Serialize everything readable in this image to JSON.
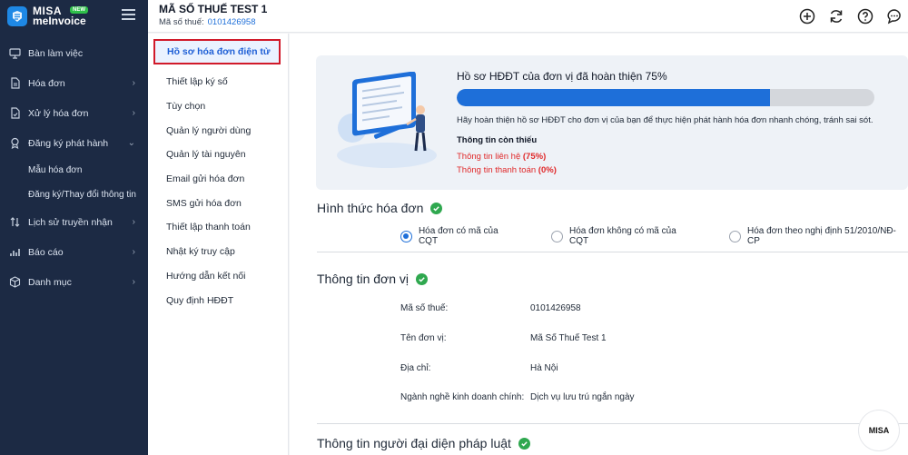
{
  "brand": {
    "name_line1": "MISA",
    "name_line2": "meInvoice",
    "badge": "NEW"
  },
  "sidebar": {
    "items": [
      {
        "label": "Bàn làm việc",
        "icon": "monitor-icon",
        "has_chevron": false
      },
      {
        "label": "Hóa đơn",
        "icon": "invoice-icon",
        "has_chevron": true
      },
      {
        "label": "Xử lý hóa đơn",
        "icon": "process-invoice-icon",
        "has_chevron": true
      },
      {
        "label": "Đăng ký phát hành",
        "icon": "award-icon",
        "has_chevron": true,
        "expanded": true
      },
      {
        "label": "Lịch sử truyền nhận",
        "icon": "transfer-icon",
        "has_chevron": true
      },
      {
        "label": "Báo cáo",
        "icon": "bar-chart-icon",
        "has_chevron": true
      },
      {
        "label": "Danh mục",
        "icon": "cube-icon",
        "has_chevron": true
      }
    ],
    "subitems": [
      "Mẫu hóa đơn",
      "Đăng ký/Thay đổi thông tin"
    ]
  },
  "header": {
    "company": "MÃ SỐ THUẾ TEST 1",
    "tax_label": "Mã số thuế:",
    "tax_value": "0101426958",
    "icons": [
      "add-circle-icon",
      "refresh-icon",
      "help-icon",
      "chat-icon"
    ]
  },
  "settings_menu": {
    "active": "Hồ sơ hóa đơn điện tử",
    "items": [
      "Thiết lập ký số",
      "Tùy chọn",
      "Quản lý người dùng",
      "Quản lý tài nguyên",
      "Email gửi hóa đơn",
      "SMS gửi hóa đơn",
      "Thiết lập thanh toán",
      "Nhật ký truy cập",
      "Hướng dẫn kết nối",
      "Quy định HĐĐT"
    ]
  },
  "progress": {
    "title": "Hồ sơ HĐĐT của đơn vị đã hoàn thiện 75%",
    "percent": 75,
    "description": "Hãy hoàn thiện hồ sơ HĐĐT cho đơn vị của bạn để thực hiện phát hành hóa đơn nhanh chóng, tránh sai sót.",
    "missing_title": "Thông tin còn thiếu",
    "missing": [
      {
        "label": "Thông tin liên hệ",
        "value": "(75%)"
      },
      {
        "label": "Thông tin thanh toán",
        "value": "(0%)"
      }
    ]
  },
  "invoice_form": {
    "title": "Hình thức hóa đơn",
    "options": [
      {
        "label": "Hóa đơn có mã của CQT",
        "selected": true
      },
      {
        "label": "Hóa đơn không có mã của CQT",
        "selected": false
      },
      {
        "label": "Hóa đơn theo nghị định 51/2010/NĐ-CP",
        "selected": false
      }
    ]
  },
  "unit_info": {
    "title": "Thông tin đơn vị",
    "fields": [
      {
        "label": "Mã số thuế:",
        "value": "0101426958"
      },
      {
        "label": "Tên đơn vị:",
        "value": "Mã Số Thuế Test 1"
      },
      {
        "label": "Địa chỉ:",
        "value": "Hà Nội"
      },
      {
        "label": "Ngành nghề kinh doanh chính:",
        "value": "Dịch vụ lưu trú ngắn ngày"
      }
    ]
  },
  "legal_rep": {
    "title": "Thông tin người đại diện pháp luật"
  },
  "watermark": {
    "text": "MISA"
  },
  "colors": {
    "sidebar_bg": "#1c2a44",
    "accent": "#1e6fd9",
    "success": "#2fa84f",
    "warning": "#e0292a"
  }
}
